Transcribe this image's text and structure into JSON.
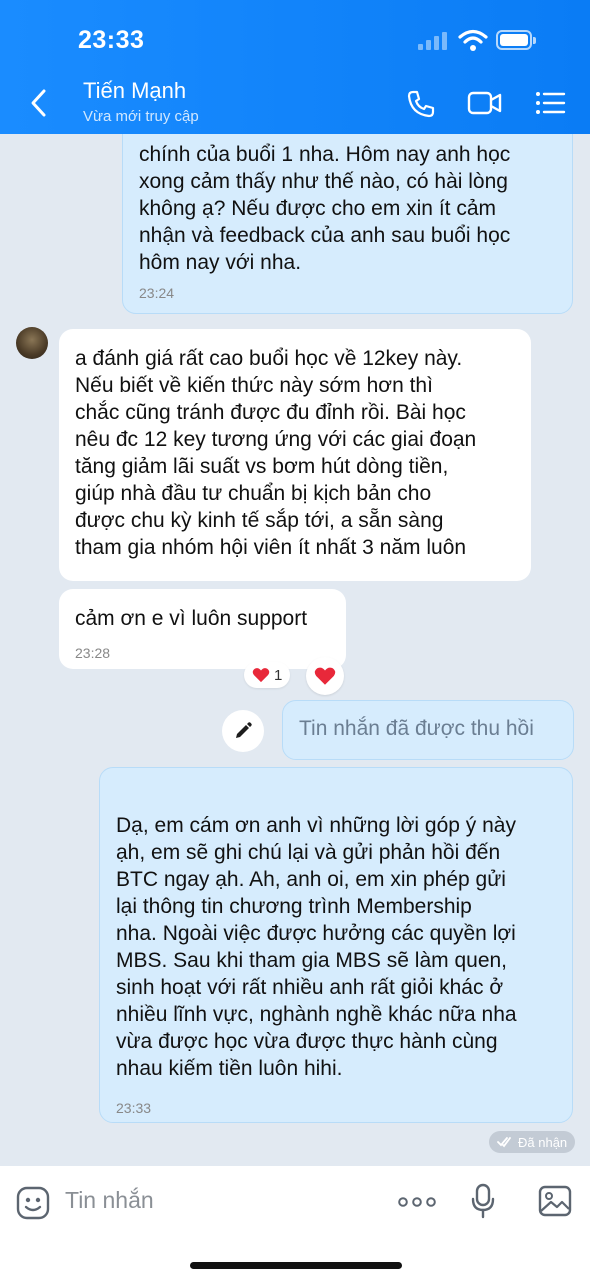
{
  "status_bar": {
    "time": "23:33"
  },
  "header": {
    "contact_name": "Tiến Mạnh",
    "contact_status": "Vừa mới truy cập"
  },
  "messages": [
    {
      "direction": "outgoing",
      "text": "chính của buổi 1 nha. Hôm nay anh  học\nxong cảm thấy như thế nào, có hài lòng\nkhông ạ? Nếu được cho em xin ít cảm\nnhận và feedback của anh sau buổi học\nhôm nay với nha.",
      "time": "23:24"
    },
    {
      "direction": "incoming",
      "text": "a đánh giá rất cao buổi học về 12key này.\nNếu biết về kiến thức này sớm hơn thì\nchắc cũng tránh được đu đỉnh rồi. Bài học\nnêu đc 12 key tương ứng với các giai đoạn\ntăng giảm lãi suất vs bơm hút dòng tiền,\ngiúp nhà đầu tư chuẩn bị kịch bản cho\nđược chu kỳ kinh tế sắp tới, a sẵn sàng\ntham gia nhóm hội viên ít nhất 3 năm luôn"
    },
    {
      "direction": "incoming",
      "text": "cảm ơn e vì luôn support",
      "time": "23:28",
      "reaction_count": "1"
    },
    {
      "direction": "outgoing",
      "recalled_text": "Tin nhắn đã được thu hồi"
    },
    {
      "direction": "outgoing",
      "text": "Dạ, em cám ơn anh vì những lời góp ý này\nạh, em sẽ ghi chú lại và gửi phản hồi đến\nBTC ngay ạh. Ah, anh  oi, em xin phép gửi\nlại thông tin chương trình Membership\nnha. Ngoài việc được hưởng các quyền lợi\nMBS. Sau khi tham gia MBS sẽ làm quen,\nsinh hoạt với rất nhiều anh rất giỏi khác ở\nnhiều lĩnh vực, nghành nghề khác nữa nha\nvừa được học vừa được thực hành cùng\nnhau kiếm tiền luôn hihi.",
      "time": "23:33",
      "receipt": "Đã nhận"
    }
  ],
  "composer": {
    "placeholder": "Tin nhắn"
  },
  "colors": {
    "header": "#1a8cff",
    "outgoing_bubble": "#d6ecfd",
    "incoming_bubble": "#ffffff",
    "background": "#e2e9f1"
  },
  "icons": [
    "back-icon",
    "phone-icon",
    "video-call-icon",
    "menu-icon",
    "heart-icon",
    "pencil-icon",
    "check-icon",
    "sticker-icon",
    "more-icon",
    "microphone-icon",
    "gallery-icon"
  ]
}
